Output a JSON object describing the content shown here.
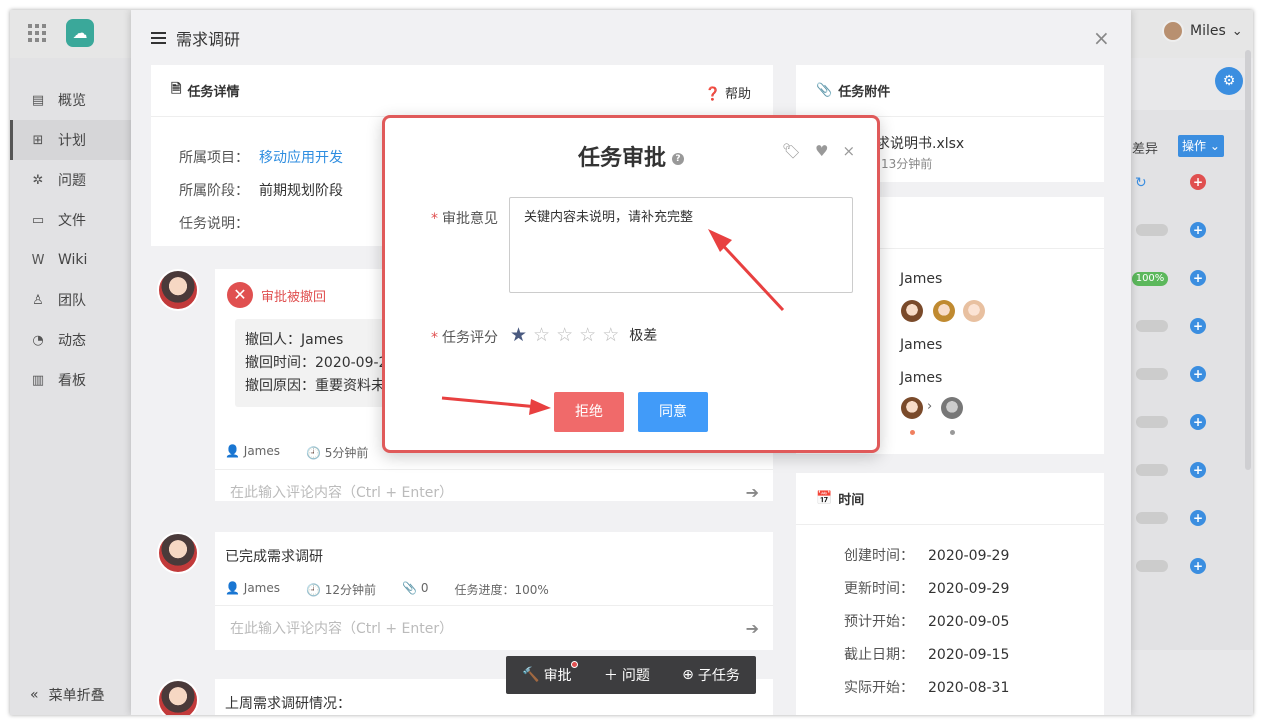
{
  "app": {
    "user": "Miles"
  },
  "sidebar": {
    "items": [
      {
        "label": "概览",
        "icon": "📋"
      },
      {
        "label": "计划",
        "icon": "品"
      },
      {
        "label": "问题",
        "icon": "✲"
      },
      {
        "label": "文件",
        "icon": "▭"
      },
      {
        "label": "Wiki",
        "icon": "W"
      },
      {
        "label": "团队",
        "icon": "♙"
      },
      {
        "label": "动态",
        "icon": "◔"
      },
      {
        "label": "看板",
        "icon": "▥"
      }
    ],
    "collapse": "菜单折叠"
  },
  "bg": {
    "label": "差异",
    "op": "操作",
    "progress": "100%"
  },
  "panel": {
    "title": "需求调研"
  },
  "details": {
    "head": "任务详情",
    "help": "帮助",
    "project_label": "所属项目：",
    "project_value": "移动应用开发",
    "stage_label": "所属阶段：",
    "stage_value": "前期规划阶段",
    "desc_label": "任务说明："
  },
  "comment1": {
    "status": "审批被撤回",
    "revoker": "撤回人：James",
    "time": "撤回时间：2020-09-29",
    "reason": "撤回原因：重要资料未",
    "author": "James",
    "ago": "5分钟前",
    "input": "在此输入评论内容（Ctrl + Enter）"
  },
  "comment2": {
    "text": "已完成需求调研",
    "author": "James",
    "ago": "12分钟前",
    "files": "0",
    "progress": "任务进度：100%",
    "input": "在此输入评论内容（Ctrl + Enter）"
  },
  "comment3": {
    "text": "上周需求调研情况："
  },
  "toolbar": {
    "approve": "审批",
    "issue": "问题",
    "subtask": "子任务"
  },
  "attach": {
    "head": "任务附件",
    "file": "求说明书.xlsx",
    "ago": "13分钟前"
  },
  "people": {
    "r1": "James",
    "r3": "James",
    "r4": "James"
  },
  "times": {
    "head": "时间",
    "rows": [
      {
        "label": "创建时间：",
        "value": "2020-09-29"
      },
      {
        "label": "更新时间：",
        "value": "2020-09-29"
      },
      {
        "label": "预计开始：",
        "value": "2020-09-05"
      },
      {
        "label": "截止日期：",
        "value": "2020-09-15"
      },
      {
        "label": "实际开始：",
        "value": "2020-08-31"
      }
    ]
  },
  "dialog": {
    "title": "任务审批",
    "opinion_label": "审批意见",
    "opinion_value": "关键内容未说明，请补充完整",
    "rating_label": "任务评分",
    "rating": 1,
    "rating_max": 5,
    "rating_word": "极差",
    "reject": "拒绝",
    "agree": "同意"
  },
  "colors": {
    "accent": "#419bf9",
    "danger": "#f06a6a",
    "highlight": "#e05a5a"
  }
}
